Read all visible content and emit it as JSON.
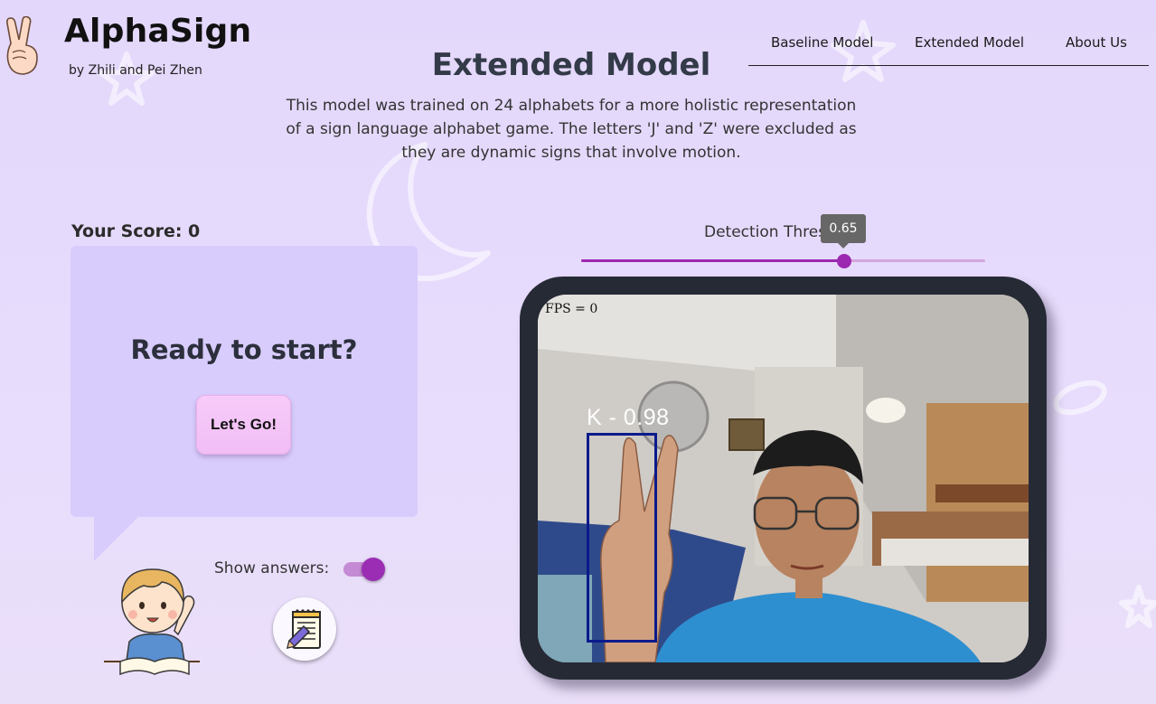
{
  "header": {
    "app_title": "AlphaSign",
    "app_subtitle": "by Zhili and Pei Zhen"
  },
  "nav": {
    "items": [
      {
        "label": "Baseline Model"
      },
      {
        "label": "Extended Model"
      },
      {
        "label": "About Us"
      }
    ]
  },
  "main": {
    "title": "Extended Model",
    "description": "This model was trained on 24 alphabets for a more holistic representation of a sign language alphabet game. The letters 'J' and 'Z' were excluded as they are dynamic signs that involve motion."
  },
  "game": {
    "score_text": "Your Score: 0",
    "ready_text": "Ready to start?",
    "go_button": "Let's Go!",
    "show_answers_label": "Show answers:",
    "show_answers_on": true
  },
  "threshold": {
    "label": "Detection Thres",
    "value": 0.65,
    "value_text": "0.65",
    "min": 0,
    "max": 1
  },
  "camera": {
    "fps_text": "FPS = 0",
    "detection_label": "K - 0.98"
  },
  "colors": {
    "accent": "#9c27b0",
    "card": "#d7ccfb",
    "frame": "#262a35",
    "box": "#0a1a8c"
  }
}
